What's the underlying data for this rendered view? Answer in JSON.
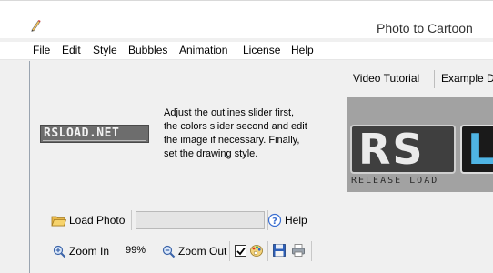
{
  "window": {
    "title": "Photo to Cartoon"
  },
  "menu": {
    "items": [
      "File",
      "Edit",
      "Style",
      "Bubbles",
      "Animation",
      "License",
      "Help"
    ]
  },
  "instructions": {
    "lines": [
      "Adjust the outlines slider first,",
      "the colors slider second and edit",
      "the image if necessary. Finally,",
      "set the drawing style."
    ]
  },
  "logo_left": {
    "text": "RSLOAD.NET"
  },
  "tabs": {
    "items": [
      "Video Tutorial",
      "Example Dr"
    ]
  },
  "preview": {
    "main_text": "RS",
    "partial_letter": "L",
    "tagline": "RELEASE LOAD"
  },
  "toolbar_top": {
    "load_label": "Load Photo",
    "file_value": "",
    "help_label": "Help"
  },
  "toolbar_bottom": {
    "zoom_in_label": "Zoom In",
    "zoom_value": "99%",
    "zoom_out_label": "Zoom Out",
    "checkbox_checked": true
  },
  "icons": {
    "app": "pencil-icon",
    "load": "folder-icon",
    "help": "question-icon",
    "zoom_in": "magnifier-plus-icon",
    "zoom_out": "magnifier-minus-icon",
    "color": "palette-icon",
    "save": "floppy-disk-icon",
    "print": "printer-icon"
  },
  "colors": {
    "preview_accent": "#4fb4e4",
    "client_bg": "#f0f0f0"
  }
}
